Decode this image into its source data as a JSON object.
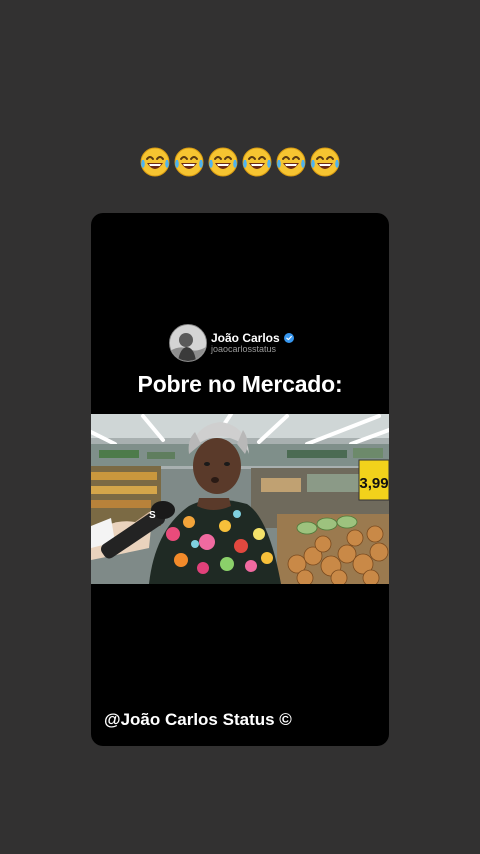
{
  "caption_emojis": [
    "😂",
    "😂",
    "😂",
    "😂",
    "😂",
    "😂"
  ],
  "post": {
    "author_name": "João Carlos",
    "author_handle": "joaocarlosstatus",
    "title": "Pobre no Mercado:",
    "video": {
      "price_tag": "3,99"
    },
    "watermark": "@João Carlos Status ©"
  }
}
